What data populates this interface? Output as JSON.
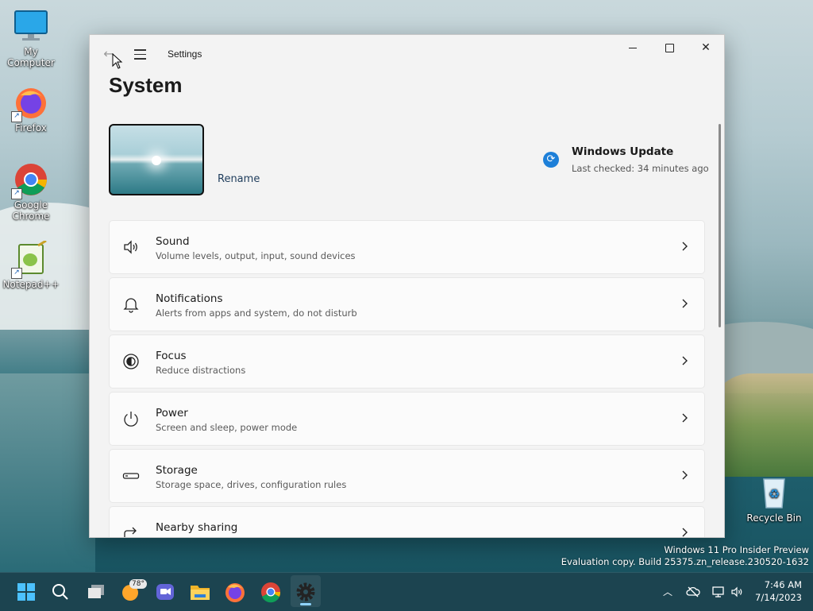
{
  "desktop": {
    "icons": [
      {
        "label": "My Computer"
      },
      {
        "label": "Firefox"
      },
      {
        "label": "Google Chrome"
      },
      {
        "label": "Notepad++"
      },
      {
        "label": "Recycle Bin"
      }
    ],
    "watermark": {
      "line1": "Windows 11 Pro Insider Preview",
      "line2": "Evaluation copy. Build 25375.zn_release.230520-1632"
    }
  },
  "window": {
    "app_title": "Settings",
    "page_title": "System",
    "device": {
      "rename_label": "Rename"
    },
    "windows_update": {
      "title": "Windows Update",
      "subtitle": "Last checked: 34 minutes ago",
      "icon": "sync-icon",
      "color": "#1d7fd8"
    },
    "items": [
      {
        "title": "Sound",
        "subtitle": "Volume levels, output, input, sound devices",
        "icon": "speaker-icon"
      },
      {
        "title": "Notifications",
        "subtitle": "Alerts from apps and system, do not disturb",
        "icon": "bell-icon"
      },
      {
        "title": "Focus",
        "subtitle": "Reduce distractions",
        "icon": "focus-icon"
      },
      {
        "title": "Power",
        "subtitle": "Screen and sleep, power mode",
        "icon": "power-icon"
      },
      {
        "title": "Storage",
        "subtitle": "Storage space, drives, configuration rules",
        "icon": "storage-icon"
      },
      {
        "title": "Nearby sharing",
        "subtitle": "",
        "icon": "share-icon"
      }
    ]
  },
  "taskbar": {
    "weather_badge": "78°",
    "apps": [
      "start-icon",
      "search-icon",
      "task-view-icon",
      "weather-icon",
      "chat-icon",
      "file-explorer-icon",
      "firefox-icon",
      "chrome-icon",
      "settings-icon"
    ],
    "clock": {
      "time": "7:46 AM",
      "date": "7/14/2023"
    }
  }
}
